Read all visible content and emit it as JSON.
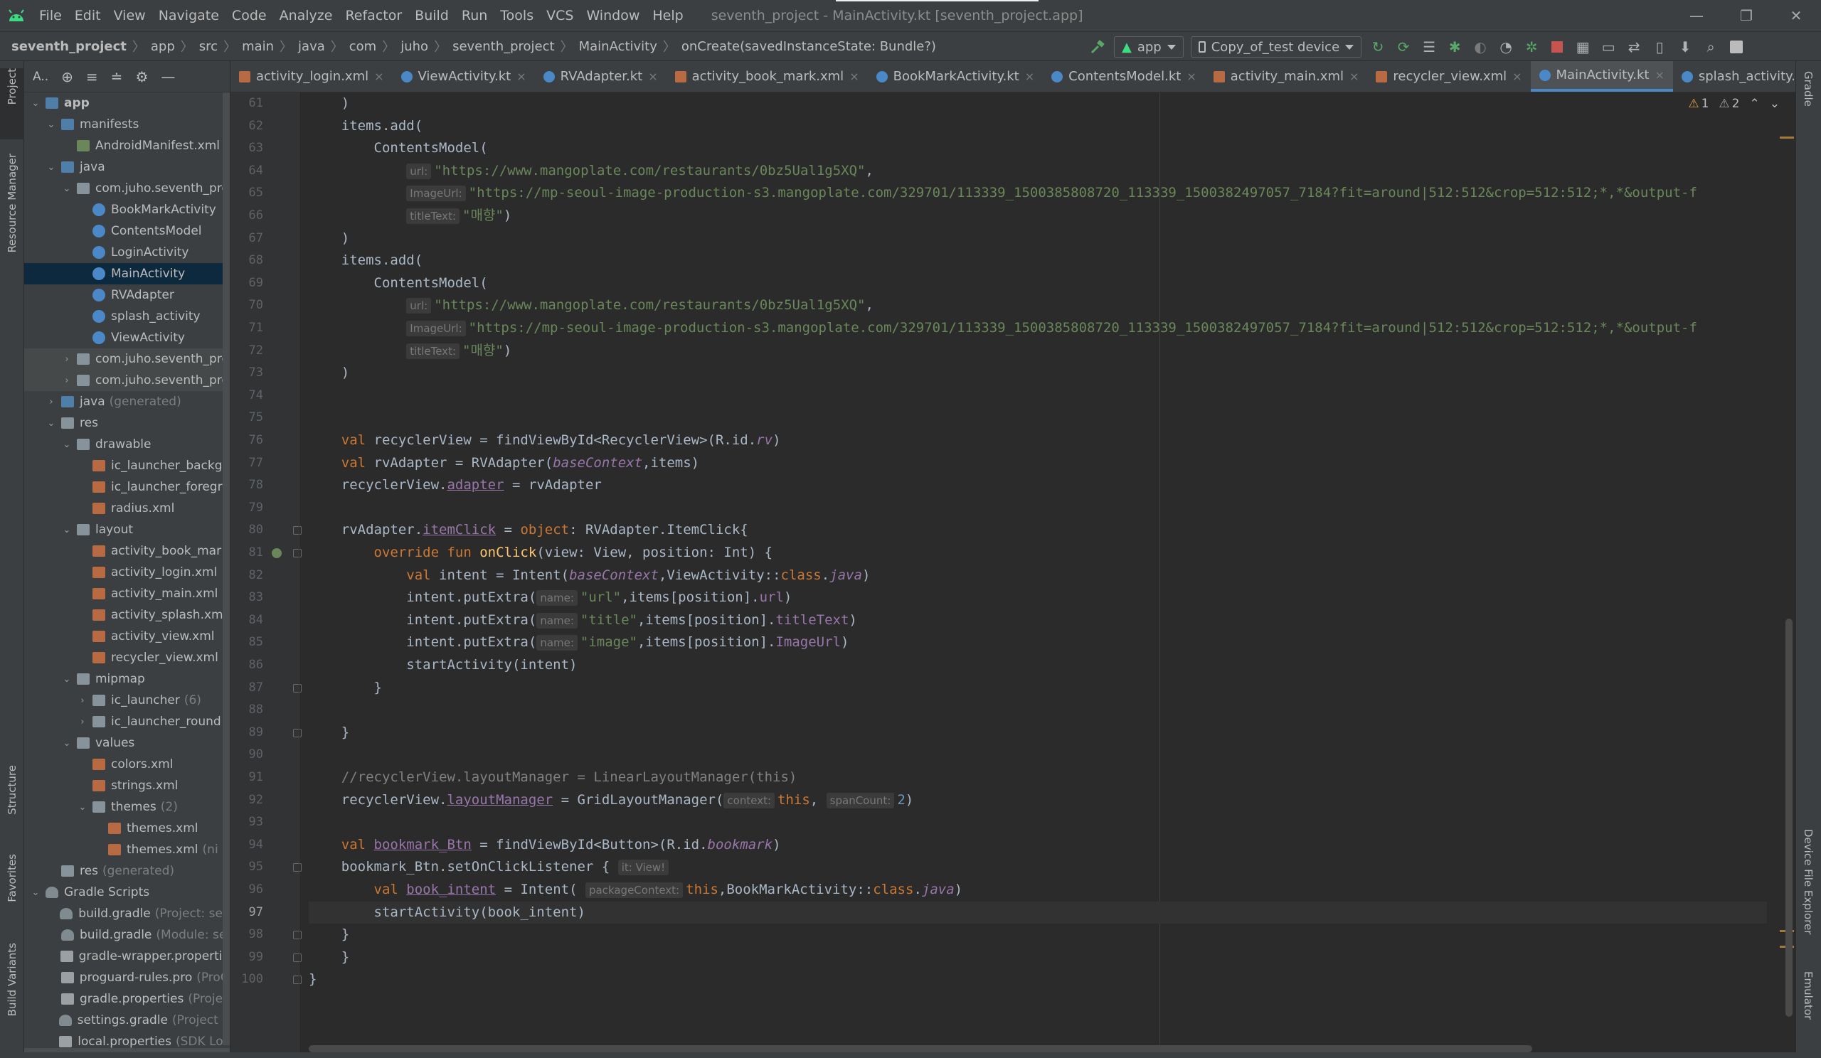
{
  "window": {
    "menu": [
      "File",
      "Edit",
      "View",
      "Navigate",
      "Code",
      "Analyze",
      "Refactor",
      "Build",
      "Run",
      "Tools",
      "VCS",
      "Window",
      "Help"
    ],
    "title": "seventh_project - MainActivity.kt [seventh_project.app]",
    "controls": {
      "minimize": "—",
      "restore": "❐",
      "close": "✕"
    }
  },
  "navbar": {
    "breadcrumbs": [
      "seventh_project",
      "app",
      "src",
      "main",
      "java",
      "com",
      "juho",
      "seventh_project",
      "MainActivity",
      "onCreate(savedInstanceState: Bundle?)"
    ],
    "run_config": "app",
    "device": "Copy_of_test device"
  },
  "left_strip": {
    "tabs": [
      "Project",
      "Resource Manager",
      "Structure",
      "Favorites",
      "Build Variants"
    ]
  },
  "right_strip": {
    "tabs": [
      "Gradle",
      "Device File Explorer",
      "Emulator"
    ]
  },
  "project_panel": {
    "selector": "A..",
    "tree": [
      {
        "label": "app",
        "hint": "",
        "depth": 0,
        "arrow": "v",
        "icon": "folder-blue",
        "bold": true
      },
      {
        "label": "manifests",
        "hint": "",
        "depth": 1,
        "arrow": "v",
        "icon": "folder-blue"
      },
      {
        "label": "AndroidManifest.xml",
        "hint": "",
        "depth": 2,
        "arrow": "",
        "icon": "manifest"
      },
      {
        "label": "java",
        "hint": "",
        "depth": 1,
        "arrow": "v",
        "icon": "folder-blue"
      },
      {
        "label": "com.juho.seventh_pro",
        "hint": "",
        "depth": 2,
        "arrow": "v",
        "icon": "folder"
      },
      {
        "label": "BookMarkActivity",
        "hint": "",
        "depth": 3,
        "arrow": "",
        "icon": "kotlin"
      },
      {
        "label": "ContentsModel",
        "hint": "",
        "depth": 3,
        "arrow": "",
        "icon": "kotlin"
      },
      {
        "label": "LoginActivity",
        "hint": "",
        "depth": 3,
        "arrow": "",
        "icon": "kotlin"
      },
      {
        "label": "MainActivity",
        "hint": "",
        "depth": 3,
        "arrow": "",
        "icon": "kotlin",
        "selected": true
      },
      {
        "label": "RVAdapter",
        "hint": "",
        "depth": 3,
        "arrow": "",
        "icon": "kotlin"
      },
      {
        "label": "splash_activity",
        "hint": "",
        "depth": 3,
        "arrow": "",
        "icon": "kotlin"
      },
      {
        "label": "ViewActivity",
        "hint": "",
        "depth": 3,
        "arrow": "",
        "icon": "kotlin"
      },
      {
        "label": "com.juho.seventh_pro",
        "hint": "",
        "depth": 2,
        "arrow": ">",
        "icon": "folder",
        "dim": true
      },
      {
        "label": "com.juho.seventh_pro",
        "hint": "",
        "depth": 2,
        "arrow": ">",
        "icon": "folder",
        "dim": true
      },
      {
        "label": "java",
        "hint": "(generated)",
        "depth": 1,
        "arrow": ">",
        "icon": "folder-blue"
      },
      {
        "label": "res",
        "hint": "",
        "depth": 1,
        "arrow": "v",
        "icon": "folder"
      },
      {
        "label": "drawable",
        "hint": "",
        "depth": 2,
        "arrow": "v",
        "icon": "folder"
      },
      {
        "label": "ic_launcher_backgr",
        "hint": "",
        "depth": 3,
        "arrow": "",
        "icon": "xml"
      },
      {
        "label": "ic_launcher_foregr",
        "hint": "",
        "depth": 3,
        "arrow": "",
        "icon": "xml"
      },
      {
        "label": "radius.xml",
        "hint": "",
        "depth": 3,
        "arrow": "",
        "icon": "xml"
      },
      {
        "label": "layout",
        "hint": "",
        "depth": 2,
        "arrow": "v",
        "icon": "folder"
      },
      {
        "label": "activity_book_mar",
        "hint": "",
        "depth": 3,
        "arrow": "",
        "icon": "xml"
      },
      {
        "label": "activity_login.xml",
        "hint": "",
        "depth": 3,
        "arrow": "",
        "icon": "xml"
      },
      {
        "label": "activity_main.xml",
        "hint": "",
        "depth": 3,
        "arrow": "",
        "icon": "xml"
      },
      {
        "label": "activity_splash.xml",
        "hint": "",
        "depth": 3,
        "arrow": "",
        "icon": "xml"
      },
      {
        "label": "activity_view.xml",
        "hint": "",
        "depth": 3,
        "arrow": "",
        "icon": "xml"
      },
      {
        "label": "recycler_view.xml",
        "hint": "",
        "depth": 3,
        "arrow": "",
        "icon": "xml"
      },
      {
        "label": "mipmap",
        "hint": "",
        "depth": 2,
        "arrow": "v",
        "icon": "folder"
      },
      {
        "label": "ic_launcher",
        "hint": "(6)",
        "depth": 3,
        "arrow": ">",
        "icon": "folder"
      },
      {
        "label": "ic_launcher_round",
        "hint": "",
        "depth": 3,
        "arrow": ">",
        "icon": "folder"
      },
      {
        "label": "values",
        "hint": "",
        "depth": 2,
        "arrow": "v",
        "icon": "folder"
      },
      {
        "label": "colors.xml",
        "hint": "",
        "depth": 3,
        "arrow": "",
        "icon": "xml"
      },
      {
        "label": "strings.xml",
        "hint": "",
        "depth": 3,
        "arrow": "",
        "icon": "xml"
      },
      {
        "label": "themes",
        "hint": "(2)",
        "depth": 3,
        "arrow": "v",
        "icon": "folder"
      },
      {
        "label": "themes.xml",
        "hint": "",
        "depth": 4,
        "arrow": "",
        "icon": "xml"
      },
      {
        "label": "themes.xml",
        "hint": "(ni",
        "depth": 4,
        "arrow": "",
        "icon": "xml"
      },
      {
        "label": "res",
        "hint": "(generated)",
        "depth": 1,
        "arrow": "",
        "icon": "folder"
      },
      {
        "label": "Gradle Scripts",
        "hint": "",
        "depth": 0,
        "arrow": "v",
        "icon": "gradle"
      },
      {
        "label": "build.gradle",
        "hint": "(Project: sev",
        "depth": 1,
        "arrow": "",
        "icon": "gradle"
      },
      {
        "label": "build.gradle",
        "hint": "(Module: se",
        "depth": 1,
        "arrow": "",
        "icon": "gradle"
      },
      {
        "label": "gradle-wrapper.propertie",
        "hint": "",
        "depth": 1,
        "arrow": "",
        "icon": "file"
      },
      {
        "label": "proguard-rules.pro",
        "hint": "(ProG",
        "depth": 1,
        "arrow": "",
        "icon": "file"
      },
      {
        "label": "gradle.properties",
        "hint": "(Projec",
        "depth": 1,
        "arrow": "",
        "icon": "file"
      },
      {
        "label": "settings.gradle",
        "hint": "(Project S",
        "depth": 1,
        "arrow": "",
        "icon": "gradle"
      },
      {
        "label": "local.properties",
        "hint": "(SDK Loc",
        "depth": 1,
        "arrow": "",
        "icon": "file"
      }
    ]
  },
  "tabs": [
    {
      "label": "activity_login.xml",
      "type": "xml"
    },
    {
      "label": "ViewActivity.kt",
      "type": "kt"
    },
    {
      "label": "RVAdapter.kt",
      "type": "kt"
    },
    {
      "label": "activity_book_mark.xml",
      "type": "xml"
    },
    {
      "label": "BookMarkActivity.kt",
      "type": "kt"
    },
    {
      "label": "ContentsModel.kt",
      "type": "kt"
    },
    {
      "label": "activity_main.xml",
      "type": "xml"
    },
    {
      "label": "recycler_view.xml",
      "type": "xml"
    },
    {
      "label": "MainActivity.kt",
      "type": "kt",
      "active": true
    },
    {
      "label": "splash_activity.kt",
      "type": "kt"
    }
  ],
  "inspections": {
    "warnings": "1",
    "weak_warnings": "2"
  },
  "editor": {
    "current_line": 97,
    "lines": [
      {
        "n": 61,
        "indent": 1,
        "tokens": [
          [
            "plain",
            ")"
          ]
        ]
      },
      {
        "n": 62,
        "indent": 1,
        "tokens": [
          [
            "plain",
            "items.add("
          ]
        ]
      },
      {
        "n": 63,
        "indent": 2,
        "tokens": [
          [
            "plain",
            "ContentsModel("
          ]
        ]
      },
      {
        "n": 64,
        "indent": 3,
        "tokens": [
          [
            "hint",
            "url:"
          ],
          [
            "str",
            "\"https://www.mangoplate.com/restaurants/0bz5Ual1g5XQ\""
          ],
          [
            "plain",
            ","
          ]
        ]
      },
      {
        "n": 65,
        "indent": 3,
        "tokens": [
          [
            "hint",
            "ImageUrl:"
          ],
          [
            "str",
            "\"https://mp-seoul-image-production-s3.mangoplate.com/329701/113339_1500385808720_113339_1500382497057_7184?fit=around|512:512&crop=512:512;*,*&output-f"
          ]
        ]
      },
      {
        "n": 66,
        "indent": 3,
        "tokens": [
          [
            "hint",
            "titleText:"
          ],
          [
            "str",
            "\"매향\""
          ],
          [
            "plain",
            ")"
          ]
        ]
      },
      {
        "n": 67,
        "indent": 1,
        "tokens": [
          [
            "plain",
            ")"
          ]
        ]
      },
      {
        "n": 68,
        "indent": 1,
        "tokens": [
          [
            "plain",
            "items.add("
          ]
        ]
      },
      {
        "n": 69,
        "indent": 2,
        "tokens": [
          [
            "plain",
            "ContentsModel("
          ]
        ]
      },
      {
        "n": 70,
        "indent": 3,
        "tokens": [
          [
            "hint",
            "url:"
          ],
          [
            "str",
            "\"https://www.mangoplate.com/restaurants/0bz5Ual1g5XQ\""
          ],
          [
            "plain",
            ","
          ]
        ]
      },
      {
        "n": 71,
        "indent": 3,
        "tokens": [
          [
            "hint",
            "ImageUrl:"
          ],
          [
            "str",
            "\"https://mp-seoul-image-production-s3.mangoplate.com/329701/113339_1500385808720_113339_1500382497057_7184?fit=around|512:512&crop=512:512;*,*&output-f"
          ]
        ]
      },
      {
        "n": 72,
        "indent": 3,
        "tokens": [
          [
            "hint",
            "titleText:"
          ],
          [
            "str",
            "\"매향\""
          ],
          [
            "plain",
            ")"
          ]
        ]
      },
      {
        "n": 73,
        "indent": 1,
        "tokens": [
          [
            "plain",
            ")"
          ]
        ]
      },
      {
        "n": 74,
        "indent": 0,
        "tokens": []
      },
      {
        "n": 75,
        "indent": 0,
        "tokens": []
      },
      {
        "n": 76,
        "indent": 1,
        "tokens": [
          [
            "kw",
            "val "
          ],
          [
            "plain",
            "recyclerView = findViewById<RecyclerView>(R.id."
          ],
          [
            "ital",
            "rv"
          ],
          [
            "plain",
            ")"
          ]
        ]
      },
      {
        "n": 77,
        "indent": 1,
        "tokens": [
          [
            "kw",
            "val "
          ],
          [
            "plain",
            "rvAdapter = RVAdapter("
          ],
          [
            "ital",
            "baseContext"
          ],
          [
            "plain",
            ",items)"
          ]
        ]
      },
      {
        "n": 78,
        "indent": 1,
        "tokens": [
          [
            "plain",
            "recyclerView."
          ],
          [
            "ul",
            "adapter"
          ],
          [
            "plain",
            " = rvAdapter"
          ]
        ]
      },
      {
        "n": 79,
        "indent": 0,
        "tokens": []
      },
      {
        "n": 80,
        "indent": 1,
        "tokens": [
          [
            "plain",
            "rvAdapter."
          ],
          [
            "ul",
            "itemClick"
          ],
          [
            "plain",
            " = "
          ],
          [
            "kw",
            "object"
          ],
          [
            "plain",
            ": RVAdapter.ItemClick{"
          ]
        ]
      },
      {
        "n": 81,
        "indent": 2,
        "tokens": [
          [
            "kw",
            "override fun "
          ],
          [
            "fn",
            "onClick"
          ],
          [
            "plain",
            "(view: View, position: Int) {"
          ]
        ]
      },
      {
        "n": 82,
        "indent": 3,
        "tokens": [
          [
            "kw",
            "val "
          ],
          [
            "plain",
            "intent = Intent("
          ],
          [
            "ital",
            "baseContext"
          ],
          [
            "plain",
            ",ViewActivity::"
          ],
          [
            "kw",
            "class"
          ],
          [
            "plain",
            "."
          ],
          [
            "ital",
            "java"
          ],
          [
            "plain",
            ")"
          ]
        ]
      },
      {
        "n": 83,
        "indent": 3,
        "tokens": [
          [
            "plain",
            "intent.putExtra("
          ],
          [
            "hint",
            "name:"
          ],
          [
            "str",
            "\"url\""
          ],
          [
            "plain",
            ",items[position]."
          ],
          [
            "prop",
            "url"
          ],
          [
            "plain",
            ")"
          ]
        ]
      },
      {
        "n": 84,
        "indent": 3,
        "tokens": [
          [
            "plain",
            "intent.putExtra("
          ],
          [
            "hint",
            "name:"
          ],
          [
            "str",
            "\"title\""
          ],
          [
            "plain",
            ",items[position]."
          ],
          [
            "prop",
            "titleText"
          ],
          [
            "plain",
            ")"
          ]
        ]
      },
      {
        "n": 85,
        "indent": 3,
        "tokens": [
          [
            "plain",
            "intent.putExtra("
          ],
          [
            "hint",
            "name:"
          ],
          [
            "str",
            "\"image\""
          ],
          [
            "plain",
            ",items[position]."
          ],
          [
            "prop",
            "ImageUrl"
          ],
          [
            "plain",
            ")"
          ]
        ]
      },
      {
        "n": 86,
        "indent": 3,
        "tokens": [
          [
            "plain",
            "startActivity(intent)"
          ]
        ]
      },
      {
        "n": 87,
        "indent": 2,
        "tokens": [
          [
            "plain",
            "}"
          ]
        ]
      },
      {
        "n": 88,
        "indent": 0,
        "tokens": []
      },
      {
        "n": 89,
        "indent": 1,
        "tokens": [
          [
            "plain",
            "}"
          ]
        ]
      },
      {
        "n": 90,
        "indent": 0,
        "tokens": []
      },
      {
        "n": 91,
        "indent": 1,
        "tokens": [
          [
            "cm",
            "//recyclerView.layoutManager = LinearLayoutManager(this)"
          ]
        ]
      },
      {
        "n": 92,
        "indent": 1,
        "tokens": [
          [
            "plain",
            "recyclerView."
          ],
          [
            "ul",
            "layoutManager"
          ],
          [
            "plain",
            " = GridLayoutManager("
          ],
          [
            "hint",
            "context:"
          ],
          [
            "kw",
            "this"
          ],
          [
            "plain",
            ", "
          ],
          [
            "hint",
            "spanCount:"
          ],
          [
            "num",
            "2"
          ],
          [
            "plain",
            ")"
          ]
        ]
      },
      {
        "n": 93,
        "indent": 0,
        "tokens": []
      },
      {
        "n": 94,
        "indent": 1,
        "tokens": [
          [
            "kw",
            "val "
          ],
          [
            "ul",
            "bookmark_Btn"
          ],
          [
            "plain",
            " = findViewById<Button>(R.id."
          ],
          [
            "ital",
            "bookmark"
          ],
          [
            "plain",
            ")"
          ]
        ]
      },
      {
        "n": 95,
        "indent": 1,
        "tokens": [
          [
            "plain",
            "bookmark_Btn.setOnClickListener { "
          ],
          [
            "hint",
            "it: View!"
          ]
        ]
      },
      {
        "n": 96,
        "indent": 2,
        "tokens": [
          [
            "kw",
            "val "
          ],
          [
            "ul",
            "book_intent"
          ],
          [
            "plain",
            " = Intent( "
          ],
          [
            "hint",
            "packageContext:"
          ],
          [
            "kw",
            "this"
          ],
          [
            "plain",
            ",BookMarkActivity::"
          ],
          [
            "kw",
            "class"
          ],
          [
            "plain",
            "."
          ],
          [
            "ital",
            "java"
          ],
          [
            "plain",
            ")"
          ]
        ]
      },
      {
        "n": 97,
        "indent": 2,
        "tokens": [
          [
            "plain",
            "startActivity(book_intent)"
          ]
        ]
      },
      {
        "n": 98,
        "indent": 1,
        "tokens": [
          [
            "plain",
            "}"
          ]
        ]
      },
      {
        "n": 99,
        "indent": 0,
        "tokens": [
          [
            "plain",
            "    }"
          ]
        ]
      },
      {
        "n": 100,
        "indent": 0,
        "tokens": [
          [
            "plain",
            "}"
          ]
        ]
      }
    ]
  }
}
